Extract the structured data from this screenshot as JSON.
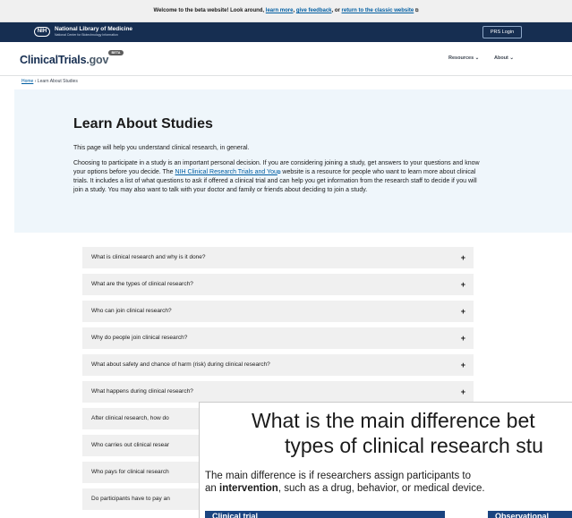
{
  "banner": {
    "prefix": "Welcome to the beta website! Look around,",
    "learn_more": "learn more",
    "sep1": ",",
    "give_feedback": "give feedback",
    "sep2": ", or",
    "return_classic": "return to the classic website",
    "ext_icon": "⧉"
  },
  "nlm": {
    "badge": "NIH",
    "title": "National Library of Medicine",
    "subtitle": "National Center for Biotechnology Information",
    "prs_login": "PRS Login"
  },
  "header": {
    "logo_main": "ClinicalTrials",
    "logo_gov": ".gov",
    "beta_pill": "BETA",
    "nav": [
      "Resources ⌄",
      "About ⌄"
    ]
  },
  "breadcrumb": {
    "home": "Home",
    "sep": " › ",
    "current": "Learn About Studies"
  },
  "intro": {
    "title": "Learn About Studies",
    "p1": "This page will help you understand clinical research, in general.",
    "p2_a": "Choosing to participate in a study is an important personal decision. If you are considering joining a study, get answers to your questions and know your options before you decide. The ",
    "p2_link": "NIH Clinical Research Trials and You",
    "p2_ext": "⧉",
    "p2_b": " website is a resource for people who want to learn more about clinical trials. It includes a list of what questions to ask if offered a clinical trial and can help you get information from the research staff to decide if you will join a study. You may also want to talk with your doctor and family or friends about deciding to join a study."
  },
  "accordion": {
    "expand_icon": "+",
    "items": [
      "What is clinical research and why is it done?",
      "What are the types of clinical research?",
      "Who can join clinical research?",
      "Why do people join clinical research?",
      "What about safety and chance of harm (risk) during clinical research?",
      "What happens during clinical research?",
      "After clinical research, how do",
      "Who carries out clinical resear",
      "Who pays for clinical research",
      "Do participants have to pay an"
    ]
  },
  "overlay": {
    "heading_line1": "What is the main difference bet",
    "heading_line2": "types of clinical research stu",
    "para_a": "The main difference is if researchers assign participants to",
    "para_b": "an ",
    "para_bold": "intervention",
    "para_c": ", such as a drug, behavior, or medical device.",
    "tab1": "Clinical trial",
    "tab2": "Observational"
  },
  "colors": {
    "nlm_bar": "#162e51",
    "intro_bg": "#eff6fb",
    "link": "#005ea2",
    "accordion_bg": "#f0f0f0",
    "overlay_tab": "#1a4480"
  }
}
